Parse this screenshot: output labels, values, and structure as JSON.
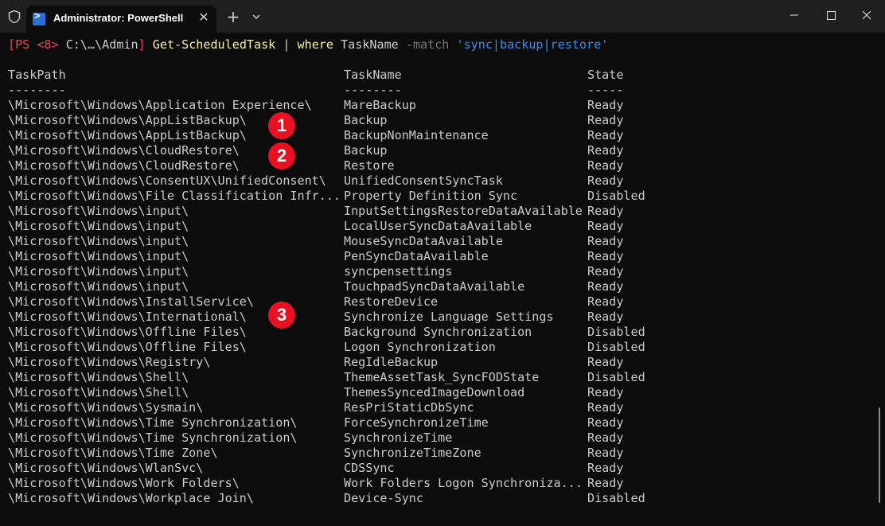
{
  "window": {
    "tab_title": "Administrator: PowerShell",
    "tab_icon": "powershell-icon"
  },
  "prompt": {
    "open": "[PS <8>",
    "path": " C:\\…\\Admin",
    "close": "]",
    "cmd": " Get-ScheduledTask",
    "pipe": " | ",
    "where": "where",
    "arg1": " TaskName",
    "param": " -match",
    "string": " 'sync|backup|restore'"
  },
  "headers": {
    "path": "TaskPath",
    "name": "TaskName",
    "state": "State"
  },
  "underlines": {
    "path": "--------",
    "name": "--------",
    "state": "-----"
  },
  "rows": [
    {
      "path": "\\Microsoft\\Windows\\Application Experience\\",
      "name": "MareBackup",
      "state": "Ready"
    },
    {
      "path": "\\Microsoft\\Windows\\AppListBackup\\",
      "name": "Backup",
      "state": "Ready"
    },
    {
      "path": "\\Microsoft\\Windows\\AppListBackup\\",
      "name": "BackupNonMaintenance",
      "state": "Ready"
    },
    {
      "path": "\\Microsoft\\Windows\\CloudRestore\\",
      "name": "Backup",
      "state": "Ready"
    },
    {
      "path": "\\Microsoft\\Windows\\CloudRestore\\",
      "name": "Restore",
      "state": "Ready"
    },
    {
      "path": "\\Microsoft\\Windows\\ConsentUX\\UnifiedConsent\\",
      "name": "UnifiedConsentSyncTask",
      "state": "Ready"
    },
    {
      "path": "\\Microsoft\\Windows\\File Classification Infr...",
      "name": "Property Definition Sync",
      "state": "Disabled"
    },
    {
      "path": "\\Microsoft\\Windows\\input\\",
      "name": "InputSettingsRestoreDataAvailable",
      "state": "Ready"
    },
    {
      "path": "\\Microsoft\\Windows\\input\\",
      "name": "LocalUserSyncDataAvailable",
      "state": "Ready"
    },
    {
      "path": "\\Microsoft\\Windows\\input\\",
      "name": "MouseSyncDataAvailable",
      "state": "Ready"
    },
    {
      "path": "\\Microsoft\\Windows\\input\\",
      "name": "PenSyncDataAvailable",
      "state": "Ready"
    },
    {
      "path": "\\Microsoft\\Windows\\input\\",
      "name": "syncpensettings",
      "state": "Ready"
    },
    {
      "path": "\\Microsoft\\Windows\\input\\",
      "name": "TouchpadSyncDataAvailable",
      "state": "Ready"
    },
    {
      "path": "\\Microsoft\\Windows\\InstallService\\",
      "name": "RestoreDevice",
      "state": "Ready"
    },
    {
      "path": "\\Microsoft\\Windows\\International\\",
      "name": "Synchronize Language Settings",
      "state": "Ready"
    },
    {
      "path": "\\Microsoft\\Windows\\Offline Files\\",
      "name": "Background Synchronization",
      "state": "Disabled"
    },
    {
      "path": "\\Microsoft\\Windows\\Offline Files\\",
      "name": "Logon Synchronization",
      "state": "Disabled"
    },
    {
      "path": "\\Microsoft\\Windows\\Registry\\",
      "name": "RegIdleBackup",
      "state": "Ready"
    },
    {
      "path": "\\Microsoft\\Windows\\Shell\\",
      "name": "ThemeAssetTask_SyncFODState",
      "state": "Disabled"
    },
    {
      "path": "\\Microsoft\\Windows\\Shell\\",
      "name": "ThemesSyncedImageDownload",
      "state": "Ready"
    },
    {
      "path": "\\Microsoft\\Windows\\Sysmain\\",
      "name": "ResPriStaticDbSync",
      "state": "Ready"
    },
    {
      "path": "\\Microsoft\\Windows\\Time Synchronization\\",
      "name": "ForceSynchronizeTime",
      "state": "Ready"
    },
    {
      "path": "\\Microsoft\\Windows\\Time Synchronization\\",
      "name": "SynchronizeTime",
      "state": "Ready"
    },
    {
      "path": "\\Microsoft\\Windows\\Time Zone\\",
      "name": "SynchronizeTimeZone",
      "state": "Ready"
    },
    {
      "path": "\\Microsoft\\Windows\\WlanSvc\\",
      "name": "CDSSync",
      "state": "Ready"
    },
    {
      "path": "\\Microsoft\\Windows\\Work Folders\\",
      "name": "Work Folders Logon Synchroniza...",
      "state": "Ready"
    },
    {
      "path": "\\Microsoft\\Windows\\Workplace Join\\",
      "name": "Device-Sync",
      "state": "Disabled"
    }
  ],
  "badges": [
    "1",
    "2",
    "3"
  ],
  "colors": {
    "badge": "#e81123",
    "prompt_red": "#e74856",
    "cmd_yellow": "#f9f1a5",
    "string_blue": "#3b8eea",
    "param_gray": "#767676"
  }
}
